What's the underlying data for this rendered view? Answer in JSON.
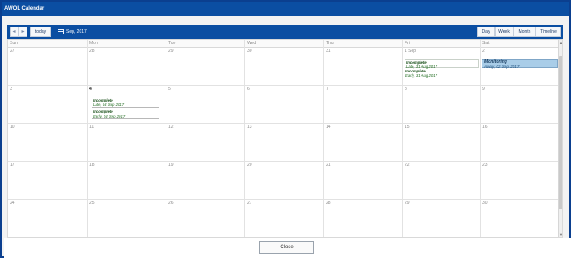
{
  "window": {
    "title": "AWOL Calendar"
  },
  "toolbar": {
    "prev": "◂",
    "next": "▸",
    "today": "today",
    "date_label": "Sep, 2017",
    "views": [
      "Day",
      "Week",
      "Month",
      "Timeline"
    ]
  },
  "calendar": {
    "weekdays": [
      "Sun",
      "Mon",
      "Tue",
      "Wed",
      "Thu",
      "Fri",
      "Sat"
    ],
    "weeks": [
      [
        "27",
        "28",
        "29",
        "30",
        "31",
        "1 Sep",
        "2"
      ],
      [
        "3",
        "4",
        "5",
        "6",
        "7",
        "8",
        "9"
      ],
      [
        "10",
        "11",
        "12",
        "13",
        "14",
        "15",
        "16"
      ],
      [
        "17",
        "18",
        "19",
        "20",
        "21",
        "22",
        "23"
      ],
      [
        "24",
        "25",
        "26",
        "27",
        "28",
        "29",
        "30"
      ]
    ],
    "events": {
      "fri1a": {
        "title": "Incomplete",
        "detail": "Late, 31 Aug 2017"
      },
      "fri1b": {
        "title": "Incomplete",
        "detail": "Early, 31 Aug 2017"
      },
      "sat2": {
        "title": "Monitoring",
        "detail": "Away, 02 Sep 2017"
      },
      "mon4a": {
        "title": "Incomplete",
        "detail": "Late, 04 Sep 2017"
      },
      "mon4b": {
        "title": "Incomplete",
        "detail": "Early, 04 Sep 2017"
      }
    }
  },
  "footer": {
    "close": "Close"
  },
  "colors": {
    "accent": "#0b4ea2",
    "monitor": "#a9cde8",
    "event_text": "#1f6b1f"
  }
}
